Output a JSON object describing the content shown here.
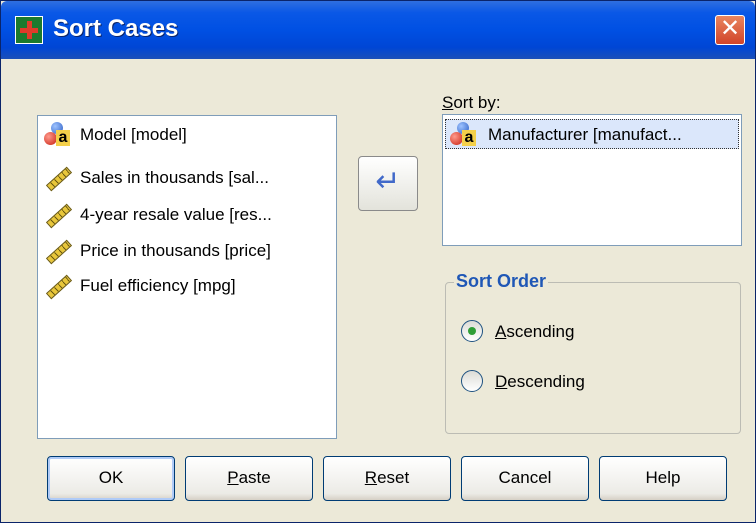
{
  "window": {
    "title": "Sort Cases",
    "close_symbol": "✕"
  },
  "source_list": {
    "items": [
      {
        "label": "Model [model]",
        "icon": "nominal-variable-icon"
      },
      {
        "label": "Sales in thousands [sal...",
        "icon": "scale-variable-icon"
      },
      {
        "label": "4-year resale value [res...",
        "icon": "scale-variable-icon"
      },
      {
        "label": "Price in thousands [price]",
        "icon": "scale-variable-icon"
      },
      {
        "label": "Fuel efficiency [mpg]",
        "icon": "scale-variable-icon"
      }
    ]
  },
  "move_button": {
    "symbol": "↵",
    "icon": "move-arrow-icon"
  },
  "sort_by": {
    "label_mnemonic": "S",
    "label_rest": "ort by:",
    "items": [
      {
        "label": "Manufacturer [manufact...",
        "icon": "nominal-variable-icon"
      }
    ]
  },
  "sort_order": {
    "title": "Sort Order",
    "options": [
      {
        "mnemonic": "A",
        "rest": "scending",
        "checked": true
      },
      {
        "mnemonic": "D",
        "rest": "escending",
        "checked": false
      }
    ]
  },
  "buttons": {
    "ok": {
      "label": "OK"
    },
    "paste": {
      "mnemonic": "P",
      "rest": "aste"
    },
    "reset": {
      "mnemonic": "R",
      "rest": "eset"
    },
    "cancel": {
      "label": "Cancel"
    },
    "help": {
      "label": "Help"
    }
  }
}
